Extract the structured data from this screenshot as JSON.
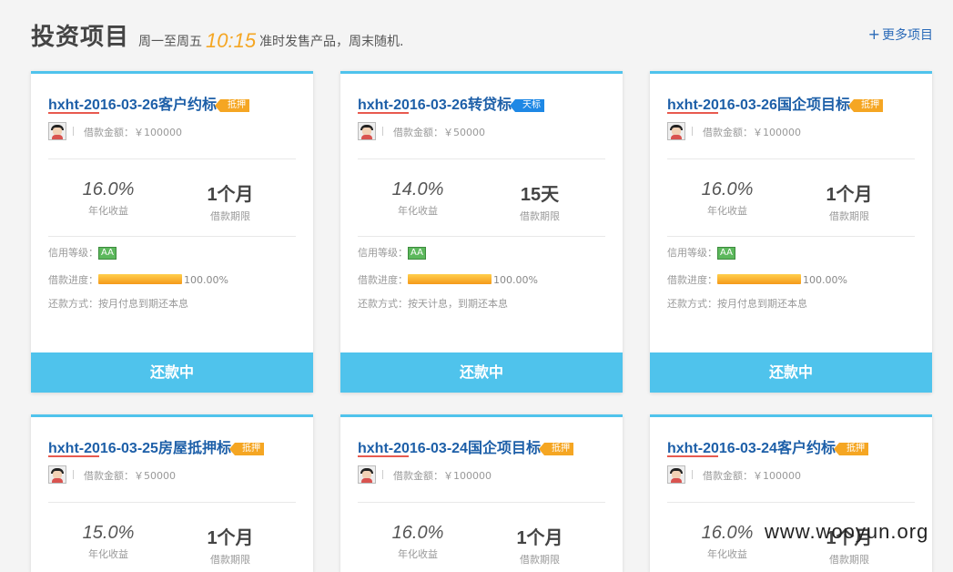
{
  "header": {
    "title": "投资项目",
    "subtitle_before": "周一至周五",
    "subtitle_time": "10:15",
    "subtitle_after": "准时发售产品，周末随机.",
    "more_icon": "plus-icon",
    "more_label": "更多项目"
  },
  "labels": {
    "amount": "借款金额：",
    "rate": "年化收益",
    "term": "借款期限",
    "credit": "信用等级：",
    "progress": "借款进度：",
    "repay": "还款方式："
  },
  "cards": [
    {
      "name": "hxht-2016-03-26客户约标",
      "tag": "抵押",
      "tag_color": "#f5a623",
      "amount": "￥100000",
      "rate": "16.0%",
      "term": "1个月",
      "credit": "AA",
      "progress": 1.0,
      "progress_text": "100.00%",
      "repay": "按月付息到期还本息",
      "button": "还款中"
    },
    {
      "name": "hxht-2016-03-26转贷标",
      "tag": "天标",
      "tag_color": "#1e88e5",
      "amount": "￥50000",
      "rate": "14.0%",
      "term": "15天",
      "credit": "AA",
      "progress": 1.0,
      "progress_text": "100.00%",
      "repay": "按天计息，到期还本息",
      "button": "还款中"
    },
    {
      "name": "hxht-2016-03-26国企项目标",
      "tag": "抵押",
      "tag_color": "#f5a623",
      "amount": "￥100000",
      "rate": "16.0%",
      "term": "1个月",
      "credit": "AA",
      "progress": 1.0,
      "progress_text": "100.00%",
      "repay": "按月付息到期还本息",
      "button": "还款中"
    },
    {
      "name": "hxht-2016-03-25房屋抵押标",
      "tag": "抵押",
      "tag_color": "#f5a623",
      "amount": "￥50000",
      "rate": "15.0%",
      "term": "1个月"
    },
    {
      "name": "hxht-2016-03-24国企项目标",
      "tag": "抵押",
      "tag_color": "#f5a623",
      "amount": "￥100000",
      "rate": "16.0%",
      "term": "1个月"
    },
    {
      "name": "hxht-2016-03-24客户约标",
      "tag": "抵押",
      "tag_color": "#f5a623",
      "amount": "￥100000",
      "rate": "16.0%",
      "term": "1个月"
    }
  ],
  "watermark": "www.wooyun.org",
  "colors": {
    "accent": "#4fc3ec",
    "title_blue": "#1d5fa8",
    "tag_orange": "#f5a623",
    "tag_blue": "#1e88e5",
    "credit_green": "#5cb85c"
  }
}
